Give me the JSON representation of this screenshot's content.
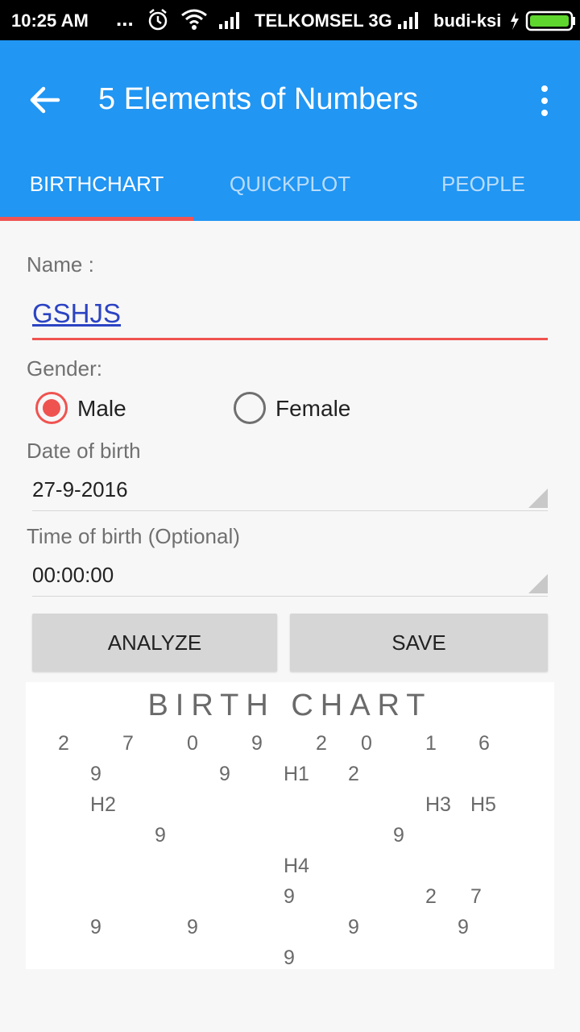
{
  "status_bar": {
    "time": "10:25 AM",
    "dots": "...",
    "carrier1": "TELKOMSEL 3G",
    "carrier2": "budi-ksi"
  },
  "icons": [
    "back-arrow-icon",
    "overflow-menu-icon",
    "alarm-icon",
    "wifi-icon",
    "signal-icon",
    "battery-charging-icon"
  ],
  "colors": {
    "primary": "#2196f3",
    "accent": "#ef5350",
    "name_text": "#2b43c3"
  },
  "app_bar": {
    "title": "5 Elements of Numbers"
  },
  "tabs": [
    {
      "label": "BIRTHCHART",
      "active": true
    },
    {
      "label": "QUICKPLOT",
      "active": false
    },
    {
      "label": "PEOPLE",
      "active": false
    }
  ],
  "form": {
    "name_label": "Name :",
    "name_value": "GSHJS",
    "gender_label": "Gender:",
    "gender_options": [
      {
        "label": "Male",
        "selected": true
      },
      {
        "label": "Female",
        "selected": false
      }
    ],
    "dob_label": "Date of birth",
    "dob_value": "27-9-2016",
    "tob_label": "Time of birth (Optional)",
    "tob_value": "00:00:00"
  },
  "buttons": {
    "analyze": "ANALYZE",
    "save": "SAVE"
  },
  "birth_chart": {
    "title": "BIRTH CHART",
    "rows": [
      [
        "2",
        "7",
        "0",
        "9",
        "2",
        "0",
        "1",
        "6"
      ],
      [
        "9",
        "9",
        "H1",
        "2"
      ],
      [
        "H2",
        "H3",
        "H5"
      ],
      [
        "9",
        "9"
      ],
      [
        "H4"
      ],
      [
        "9",
        "2",
        "7"
      ],
      [
        "9",
        "9",
        "9",
        "9"
      ],
      [
        "9"
      ]
    ]
  }
}
